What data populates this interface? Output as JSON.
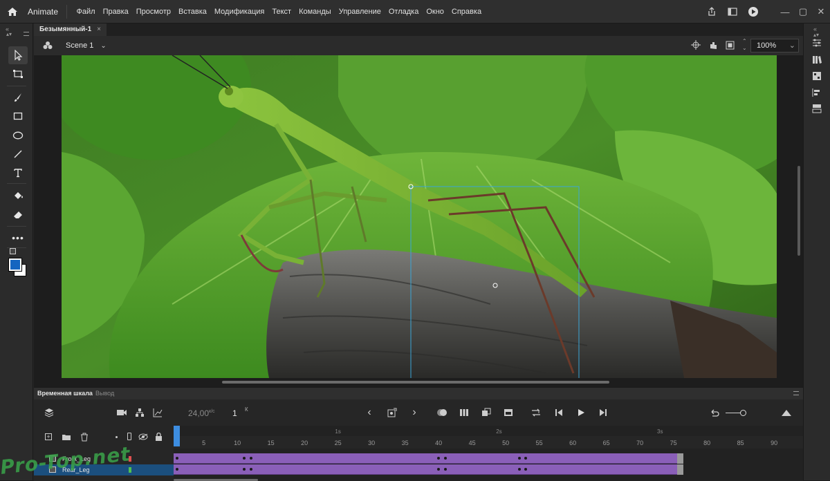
{
  "app": {
    "name": "Animate",
    "menu": [
      "Файл",
      "Правка",
      "Просмотр",
      "Вставка",
      "Модификация",
      "Текст",
      "Команды",
      "Управление",
      "Отладка",
      "Окно",
      "Справка"
    ]
  },
  "document": {
    "tab_title": "Безымянный-1",
    "tab_close": "×",
    "scene": "Scene 1",
    "zoom": "100%"
  },
  "colors": {
    "stroke": "#ffffff",
    "fill": "#1565c0",
    "accent": "#3d8de0",
    "tween": "#8a5fb8"
  },
  "timeline": {
    "tabs": [
      "Временная шкала",
      "Вывод"
    ],
    "fps": "24,00",
    "fps_unit": "к/с",
    "current_frame": "1",
    "frame_unit": "К",
    "ruler_ticks": [
      "5",
      "10",
      "15",
      "20",
      "25",
      "30",
      "35",
      "40",
      "45",
      "50",
      "55",
      "60",
      "65",
      "70",
      "75",
      "80",
      "85",
      "90"
    ],
    "seconds": [
      "1s",
      "2s",
      "3s"
    ],
    "layers": [
      {
        "name": "Front_Leg",
        "color": "#e05050",
        "selected": false,
        "keyframes": [
          1,
          11,
          12,
          40,
          41,
          52,
          53,
          76
        ]
      },
      {
        "name": "Rear_Leg",
        "color": "#50c050",
        "selected": true,
        "keyframes": [
          1,
          11,
          12,
          40,
          41,
          52,
          53,
          76
        ]
      }
    ],
    "last_frame": 76
  },
  "watermark": "Pro-Top.net"
}
